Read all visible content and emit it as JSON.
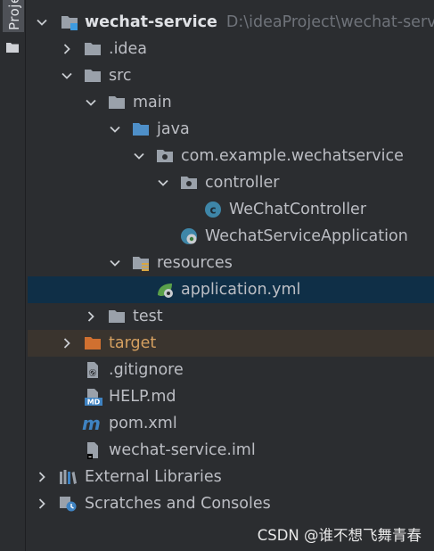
{
  "side_panel": {
    "tab_label": "Proje"
  },
  "tree": {
    "root": {
      "name": "wechat-service",
      "path": "D:\\ideaProject\\wechat-servic"
    },
    "idea": ".idea",
    "src": "src",
    "main": "main",
    "java": "java",
    "package": "com.example.wechatservice",
    "controller": "controller",
    "controller_class": "WeChatController",
    "app_class": "WechatServiceApplication",
    "resources": "resources",
    "app_yml": "application.yml",
    "test": "test",
    "target": "target",
    "gitignore": ".gitignore",
    "help": "HELP.md",
    "help_badge": "MD",
    "pom": "pom.xml",
    "iml": "wechat-service.iml",
    "ext_libs": "External Libraries",
    "scratches": "Scratches and Consoles"
  },
  "icons": {
    "expanded": "chevron-down-icon",
    "collapsed": "chevron-right-icon",
    "module": "module-folder-icon",
    "folder": "folder-icon",
    "source_root": "source-root-folder-icon",
    "package": "package-icon",
    "class": "class-icon",
    "spring_boot": "spring-boot-class-icon",
    "resources_root": "resources-root-icon",
    "yml": "spring-yml-icon",
    "excluded": "excluded-folder-icon",
    "gitignore": "gitignore-file-icon",
    "markdown": "markdown-file-icon",
    "maven": "maven-icon",
    "iml": "iml-file-icon",
    "libraries": "libraries-icon",
    "scratches": "scratches-icon"
  },
  "colors": {
    "background": "#2b2d30",
    "selection": "#0f2f47",
    "excluded_row": "#3a342e",
    "text": "#bcbec4",
    "path_text": "#6f737a",
    "source_folder": "#4e8fc8",
    "excluded_folder": "#d07030"
  },
  "watermark": "CSDN @谁不想飞舞青春"
}
